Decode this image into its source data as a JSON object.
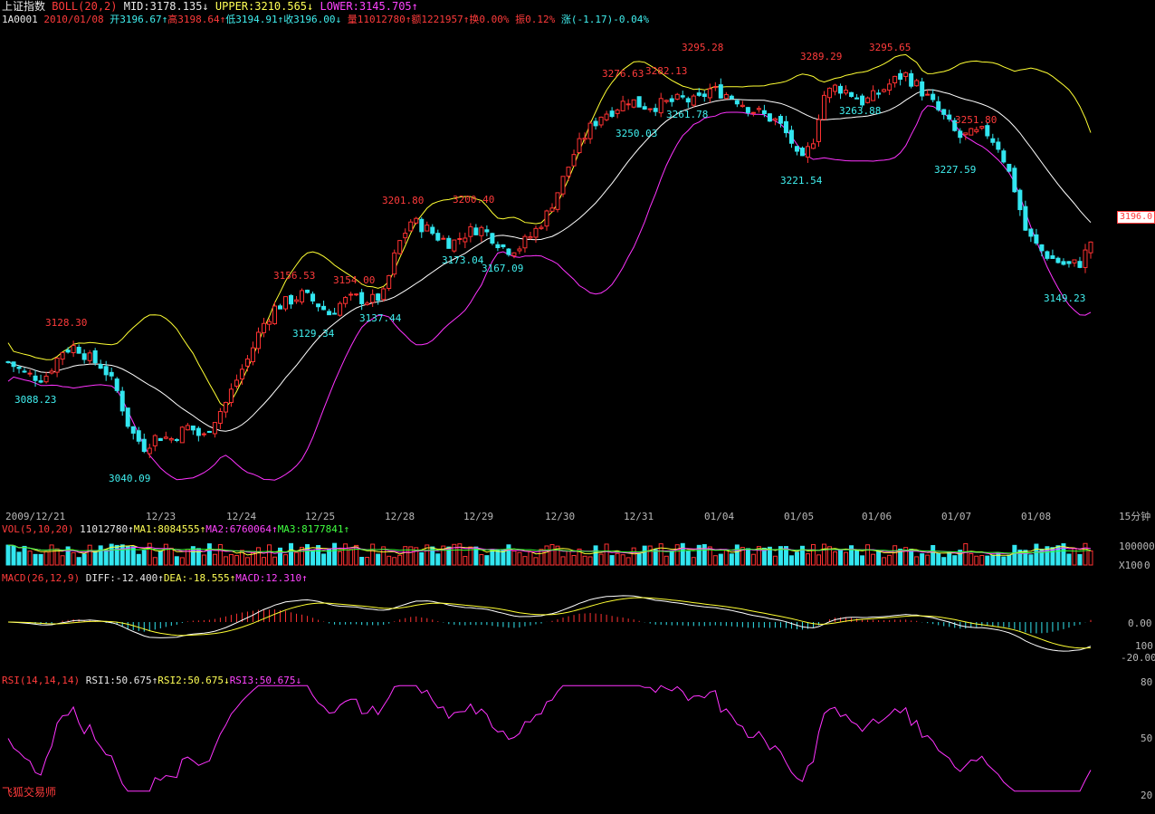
{
  "header": {
    "index_name": "上证指数",
    "boll_label": "BOLL(20,2)",
    "mid": "MID:3178.135↓",
    "upper": "UPPER:3210.565↓",
    "lower": "LOWER:3145.705↑",
    "code": "1A0001",
    "date": "2010/01/08",
    "open": "开3196.67↑",
    "high": "高3198.64↑",
    "low": "低3194.91↑",
    "close": "收3196.00↓",
    "volume": "量11012780↑",
    "amount": "额1221957↑",
    "turnover": "换0.00%",
    "amplitude": "振0.12%",
    "change": "涨(-1.17)-0.04%"
  },
  "current_price_tag": "3196.0",
  "period_label": "15分钟",
  "watermark": "飞狐交易师",
  "colors": {
    "up": "#ff3232",
    "down": "#32e6f0",
    "mid": "#ffffff",
    "upper": "#ffff33",
    "lower": "#ff33ff",
    "bg": "#000000"
  },
  "vol_header": {
    "label": "VOL(5,10,20)",
    "value": "11012780↑",
    "ma1": "MA1:8084555↑",
    "ma2": "MA2:6760064↑",
    "ma3": "MA3:8177841↑"
  },
  "vol_axis": {
    "top": "100000",
    "bottom": "X100",
    "zero": "0"
  },
  "macd_header": {
    "label": "MACD(26,12,9)",
    "diff": "DIFF:-12.400↑",
    "dea": "DEA:-18.555↑",
    "macd": "MACD:12.310↑"
  },
  "macd_axis": {
    "zero": "0.00",
    "l100": "100",
    "neg20": "-20.00"
  },
  "rsi_header": {
    "label": "RSI(14,14,14)",
    "rsi1": "RSI1:50.675↑",
    "rsi2": "RSI2:50.675↓",
    "rsi3": "RSI3:50.675↓"
  },
  "rsi_axis": {
    "t80": "80",
    "t50": "50",
    "t20": "20"
  },
  "chart_data": {
    "type": "candlestick",
    "x_labels": [
      "2009/12/21",
      "12/23",
      "12/24",
      "12/25",
      "12/28",
      "12/29",
      "12/30",
      "12/31",
      "01/04",
      "01/05",
      "01/06",
      "01/07",
      "01/08"
    ],
    "price_annotations": [
      {
        "text": "3128.30",
        "kind": "high"
      },
      {
        "text": "3088.23",
        "kind": "low"
      },
      {
        "text": "3040.09",
        "kind": "low"
      },
      {
        "text": "3156.53",
        "kind": "high"
      },
      {
        "text": "3129.34",
        "kind": "low"
      },
      {
        "text": "3154.00",
        "kind": "high"
      },
      {
        "text": "3137.44",
        "kind": "low"
      },
      {
        "text": "3201.80",
        "kind": "high"
      },
      {
        "text": "3200.40",
        "kind": "high"
      },
      {
        "text": "3173.04",
        "kind": "low"
      },
      {
        "text": "3167.09",
        "kind": "low"
      },
      {
        "text": "3276.63",
        "kind": "high"
      },
      {
        "text": "3282.13",
        "kind": "high"
      },
      {
        "text": "3295.28",
        "kind": "high"
      },
      {
        "text": "3250.03",
        "kind": "low"
      },
      {
        "text": "3261.78",
        "kind": "low"
      },
      {
        "text": "3289.29",
        "kind": "high"
      },
      {
        "text": "3263.88",
        "kind": "low"
      },
      {
        "text": "3295.65",
        "kind": "high"
      },
      {
        "text": "3221.54",
        "kind": "low"
      },
      {
        "text": "3251.80",
        "kind": "high"
      },
      {
        "text": "3227.59",
        "kind": "low"
      },
      {
        "text": "3149.23",
        "kind": "low"
      }
    ],
    "ylim": [
      3040,
      3300
    ],
    "rsi_ylim": [
      20,
      80
    ]
  }
}
